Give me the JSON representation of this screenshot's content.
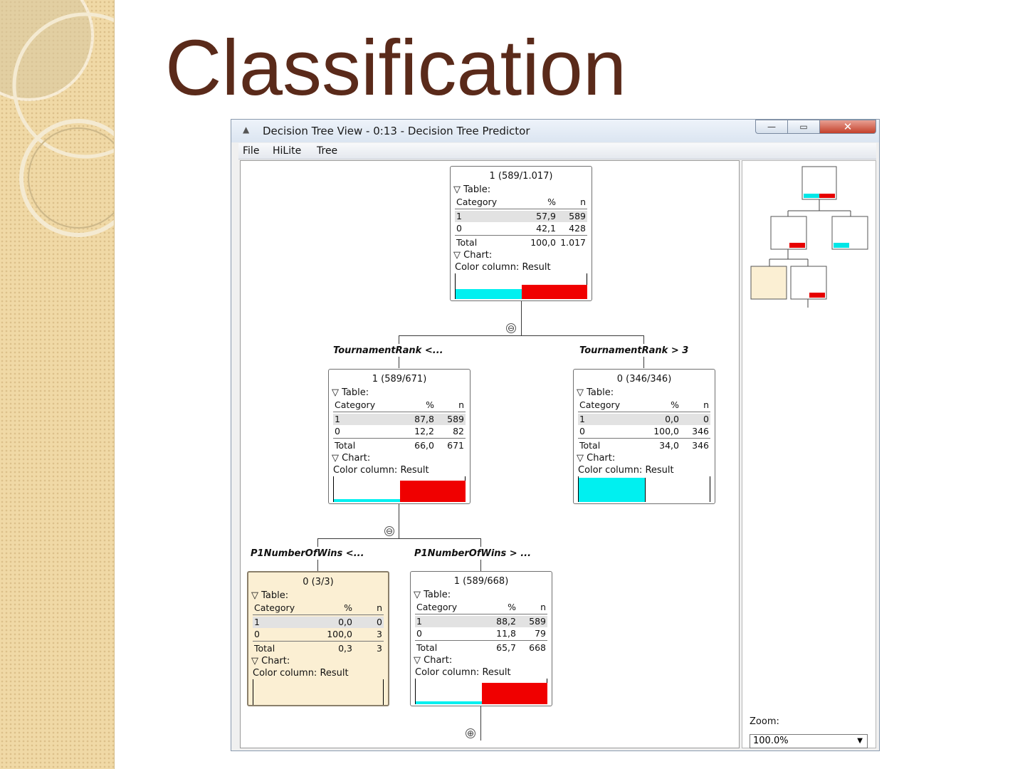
{
  "slide": {
    "title": "Classification"
  },
  "window": {
    "title": "Decision Tree View - 0:13 - Decision Tree Predictor",
    "controls": {
      "minimize": "—",
      "maximize": "▭",
      "close": "✕"
    }
  },
  "menu": [
    "File",
    "HiLite",
    "Tree"
  ],
  "labels": {
    "table": "Table:",
    "chart": "Chart:",
    "category": "Category",
    "percent": "%",
    "n": "n",
    "total": "Total",
    "color_column": "Color column: Result"
  },
  "nodes": [
    {
      "header": "1 (589/1.017)",
      "rows": [
        {
          "cat": "1",
          "pct": "57,9",
          "n": "589"
        },
        {
          "cat": "0",
          "pct": "42,1",
          "n": "428"
        }
      ],
      "total": {
        "pct": "100,0",
        "n": "1.017"
      },
      "chart": {
        "cyan": 0.421,
        "red": 0.579
      }
    },
    {
      "header": "1 (589/671)",
      "rows": [
        {
          "cat": "1",
          "pct": "87,8",
          "n": "589"
        },
        {
          "cat": "0",
          "pct": "12,2",
          "n": "82"
        }
      ],
      "total": {
        "pct": "66,0",
        "n": "671"
      },
      "chart": {
        "cyan": 0.122,
        "red": 0.878
      }
    },
    {
      "header": "0 (346/346)",
      "rows": [
        {
          "cat": "1",
          "pct": "0,0",
          "n": "0"
        },
        {
          "cat": "0",
          "pct": "100,0",
          "n": "346"
        }
      ],
      "total": {
        "pct": "34,0",
        "n": "346"
      },
      "chart": {
        "cyan": 1.0,
        "red": 0.0
      }
    },
    {
      "header": "0 (3/3)",
      "rows": [
        {
          "cat": "1",
          "pct": "0,0",
          "n": "0"
        },
        {
          "cat": "0",
          "pct": "100,0",
          "n": "3"
        }
      ],
      "total": {
        "pct": "0,3",
        "n": "3"
      },
      "chart": {
        "cyan": 0.0,
        "red": 0.0
      },
      "selected": true
    },
    {
      "header": "1 (589/668)",
      "rows": [
        {
          "cat": "1",
          "pct": "88,2",
          "n": "589"
        },
        {
          "cat": "0",
          "pct": "11,8",
          "n": "79"
        }
      ],
      "total": {
        "pct": "65,7",
        "n": "668"
      },
      "chart": {
        "cyan": 0.118,
        "red": 0.882
      }
    }
  ],
  "splits": {
    "rank_left": "TournamentRank <...",
    "rank_right": "TournamentRank > 3",
    "wins_left": "P1NumberOfWins <...",
    "wins_right": "P1NumberOfWins > ..."
  },
  "zoom": {
    "label": "Zoom:",
    "value": "100.0%"
  },
  "colors": {
    "cyan": "#00f0f0",
    "red": "#f00000",
    "selected_bg": "#fbefd3",
    "title": "#5a2a1a"
  }
}
